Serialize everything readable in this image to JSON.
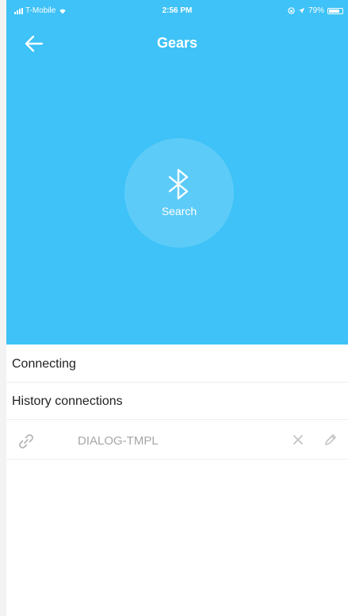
{
  "status_bar": {
    "carrier": "T-Mobile",
    "time": "2:56 PM",
    "battery": "79%",
    "battery_level": 0.79
  },
  "nav": {
    "title": "Gears",
    "back_icon": "arrow-left-icon"
  },
  "hero": {
    "background_color": "#3ec2f7",
    "search_label": "Search",
    "search_icon": "bluetooth-icon"
  },
  "sections": {
    "connecting_label": "Connecting",
    "history_label": "History connections"
  },
  "history": [
    {
      "name": "DIALOG-TMPL",
      "icon": "link-icon",
      "actions": [
        "close-icon",
        "pencil-icon"
      ]
    }
  ]
}
